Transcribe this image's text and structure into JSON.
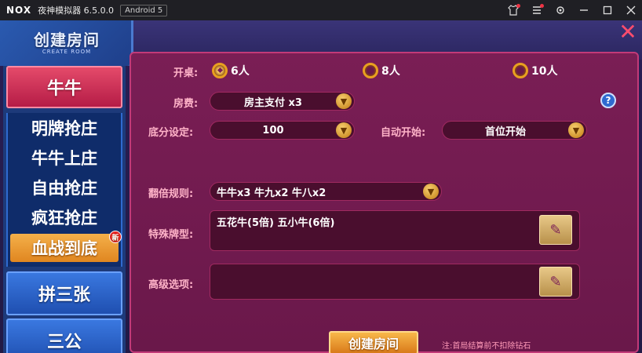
{
  "titlebar": {
    "logo": "NOX",
    "app_title": "夜神模拟器 6.5.0.0",
    "android": "Android 5",
    "icons": [
      "shirt-icon",
      "menu-icon",
      "gear-icon",
      "minimize-icon",
      "maximize-icon",
      "close-icon"
    ]
  },
  "header": {
    "title": "创建房间",
    "subtitle": "CREATE ROOM",
    "close_icon": "x-close-icon"
  },
  "sidebar": {
    "top_category": "牛牛",
    "sub_items": [
      {
        "label": "明牌抢庄"
      },
      {
        "label": "牛牛上庄"
      },
      {
        "label": "自由抢庄"
      },
      {
        "label": "疯狂抢庄"
      },
      {
        "label": "血战到底",
        "active": true,
        "badge": "新"
      }
    ],
    "categories": [
      "拼三张",
      "三公"
    ]
  },
  "form": {
    "table_label": "开桌:",
    "table_options": [
      {
        "label": "6人",
        "selected": true
      },
      {
        "label": "8人",
        "selected": false
      },
      {
        "label": "10人",
        "selected": false
      }
    ],
    "fee_label": "房费:",
    "fee_value": "房主支付 x3",
    "base_label": "底分设定:",
    "base_value": "100",
    "auto_label": "自动开始:",
    "auto_value": "首位开始",
    "multiplier_label": "翻倍规则:",
    "multiplier_value": "牛牛x3  牛九x2  牛八x2",
    "special_label": "特殊牌型:",
    "special_value": "五花牛(5倍)  五小牛(6倍)",
    "advanced_label": "高级选项:",
    "advanced_value": "",
    "create_button": "创建房间",
    "note": "注:首局结算前不扣除钻石",
    "help": "?"
  }
}
